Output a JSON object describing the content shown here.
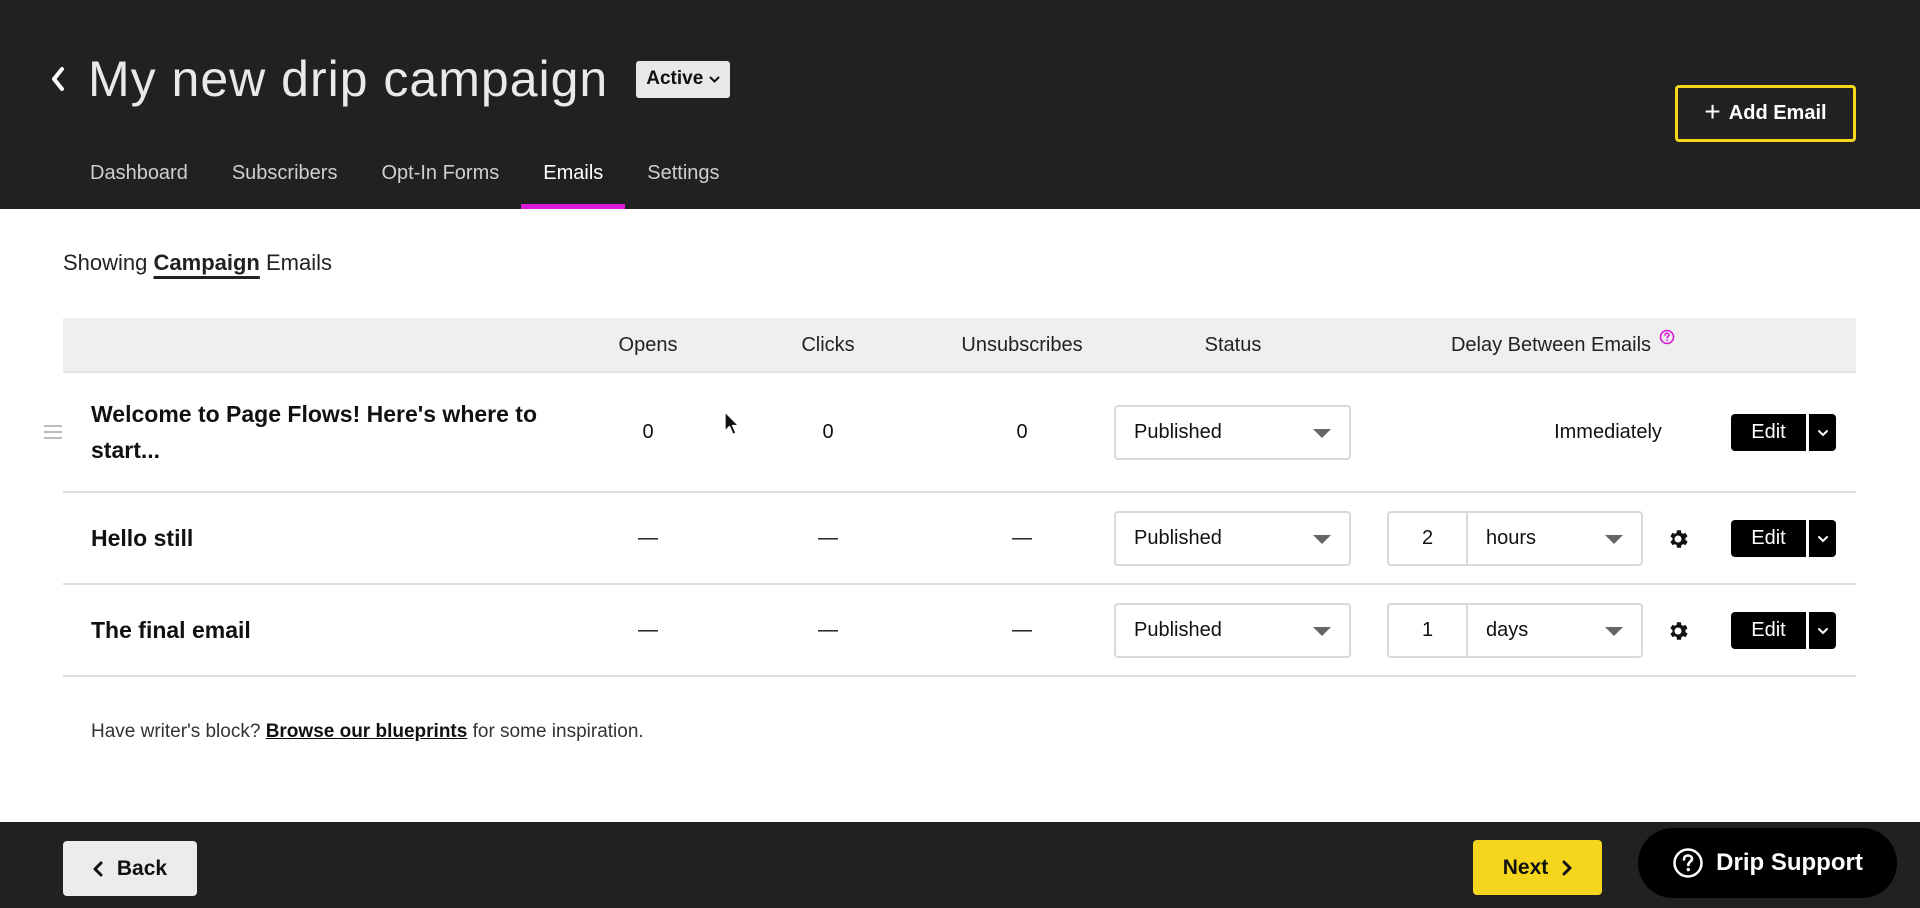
{
  "header": {
    "title": "My new drip campaign",
    "status": "Active",
    "add_email_label": "Add Email",
    "tabs": [
      {
        "label": "Dashboard",
        "active": false
      },
      {
        "label": "Subscribers",
        "active": false
      },
      {
        "label": "Opt-In Forms",
        "active": false
      },
      {
        "label": "Emails",
        "active": true
      },
      {
        "label": "Settings",
        "active": false
      }
    ]
  },
  "filter": {
    "prefix": "Showing",
    "selected": "Campaign",
    "suffix": "Emails"
  },
  "table": {
    "columns": {
      "opens": "Opens",
      "clicks": "Clicks",
      "unsubscribes": "Unsubscribes",
      "status": "Status",
      "delay": "Delay Between Emails"
    },
    "rows": [
      {
        "name": "Welcome to Page Flows! Here's where to start...",
        "opens": "0",
        "clicks": "0",
        "unsubscribes": "0",
        "status": "Published",
        "delay_text": "Immediately",
        "edit_label": "Edit"
      },
      {
        "name": "Hello still",
        "opens": "—",
        "clicks": "—",
        "unsubscribes": "—",
        "status": "Published",
        "delay_value": "2",
        "delay_unit": "hours",
        "edit_label": "Edit"
      },
      {
        "name": "The final email",
        "opens": "—",
        "clicks": "—",
        "unsubscribes": "—",
        "status": "Published",
        "delay_value": "1",
        "delay_unit": "days",
        "edit_label": "Edit"
      }
    ]
  },
  "blueprint": {
    "prefix": "Have writer's block?",
    "link": "Browse our blueprints",
    "suffix": "for some inspiration."
  },
  "footer": {
    "back_label": "Back",
    "next_label": "Next",
    "support_label": "Drip Support"
  },
  "colors": {
    "header_bg": "#212121",
    "accent_yellow": "#f5d61d",
    "active_tab_underline": "#d91ad9"
  }
}
